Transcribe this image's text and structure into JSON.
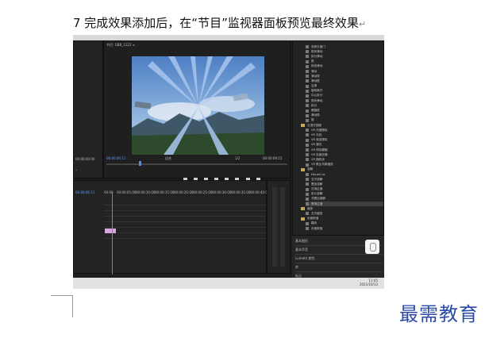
{
  "caption": {
    "text": "7 完成效果添加后，在“节目”监视器面板预览最终效果",
    "return_mark": "↵"
  },
  "program_monitor": {
    "title": "节目: GBB_1122 ≡",
    "timecode_left": "00:00:06:11",
    "fit": "适合",
    "fraction": "1/2",
    "timecode_right": "00:00:09:15"
  },
  "source_monitor": {
    "timecode_left": "00:00:00:00",
    "timecode_right": "00:00:00:00"
  },
  "timeline": {
    "timecode": "00:00:06:11",
    "ruler": [
      "00:00",
      "00:00:05:00",
      "00:00:10:00",
      "00:00:15:00",
      "00:00:20:00",
      "00:00:25:00",
      "00:00:30:00",
      "00:00:35:00",
      "00:00:40:00"
    ]
  },
  "effects": {
    "items": [
      {
        "label": "双侧平推门",
        "type": "fx",
        "selected": false
      },
      {
        "label": "带状滑动",
        "type": "fx",
        "selected": false
      },
      {
        "label": "拆分滑动",
        "type": "fx",
        "selected": false
      },
      {
        "label": "推",
        "type": "fx",
        "selected": false
      },
      {
        "label": "斜线滑动",
        "type": "fx",
        "selected": false
      },
      {
        "label": "滑动",
        "type": "fx",
        "selected": false
      },
      {
        "label": "滑动带",
        "type": "fx",
        "selected": false
      },
      {
        "label": "滑动框",
        "type": "fx",
        "selected": false
      },
      {
        "label": "互换",
        "type": "fx",
        "selected": false
      },
      {
        "label": "旋转离开",
        "type": "fx",
        "selected": false
      },
      {
        "label": "中心拆分",
        "type": "fx",
        "selected": false
      },
      {
        "label": "带状滑动",
        "type": "fx",
        "selected": false
      },
      {
        "label": "拆分",
        "type": "fx",
        "selected": false
      },
      {
        "label": "螺旋框",
        "type": "fx",
        "selected": false
      },
      {
        "label": "滑动带",
        "type": "fx",
        "selected": false
      },
      {
        "label": "推",
        "type": "fx",
        "selected": false
      },
      {
        "label": "沉浸式视频",
        "type": "folder",
        "selected": false
      },
      {
        "label": "VR 光圈擦除",
        "type": "fx",
        "selected": false
      },
      {
        "label": "VR 光线",
        "type": "fx",
        "selected": false
      },
      {
        "label": "VR 渐变擦除",
        "type": "fx",
        "selected": false
      },
      {
        "label": "VR 漏光",
        "type": "fx",
        "selected": false
      },
      {
        "label": "VR 球形模糊",
        "type": "fx",
        "selected": false
      },
      {
        "label": "VR 色度泄漏",
        "type": "fx",
        "selected": false
      },
      {
        "label": "VR 随机块",
        "type": "fx",
        "selected": false
      },
      {
        "label": "VR 默比乌斯缩放",
        "type": "fx",
        "selected": false
      },
      {
        "label": "溶解",
        "type": "folder",
        "selected": false
      },
      {
        "label": "MorphCut",
        "type": "fx",
        "selected": false
      },
      {
        "label": "交叉溶解",
        "type": "fx",
        "selected": false
      },
      {
        "label": "叠加溶解",
        "type": "fx",
        "selected": false
      },
      {
        "label": "白场过渡",
        "type": "fx",
        "selected": false
      },
      {
        "label": "胶片溶解",
        "type": "fx",
        "selected": false
      },
      {
        "label": "非叠加溶解",
        "type": "fx",
        "selected": false
      },
      {
        "label": "黑场过渡",
        "type": "fx",
        "selected": true
      },
      {
        "label": "缩放",
        "type": "folder",
        "selected": false
      },
      {
        "label": "交叉缩放",
        "type": "fx",
        "selected": false
      },
      {
        "label": "页面剥落",
        "type": "folder",
        "selected": false
      },
      {
        "label": "翻页",
        "type": "fx",
        "selected": false
      },
      {
        "label": "页面剥落",
        "type": "fx",
        "selected": false
      }
    ],
    "lower_panels": [
      "基本图形",
      "基本声音",
      "Lumetri 颜色",
      "库",
      "标记"
    ]
  },
  "taskbar": {
    "time": "11:05",
    "date": "2021/10/13"
  },
  "watermark": "最需教育"
}
